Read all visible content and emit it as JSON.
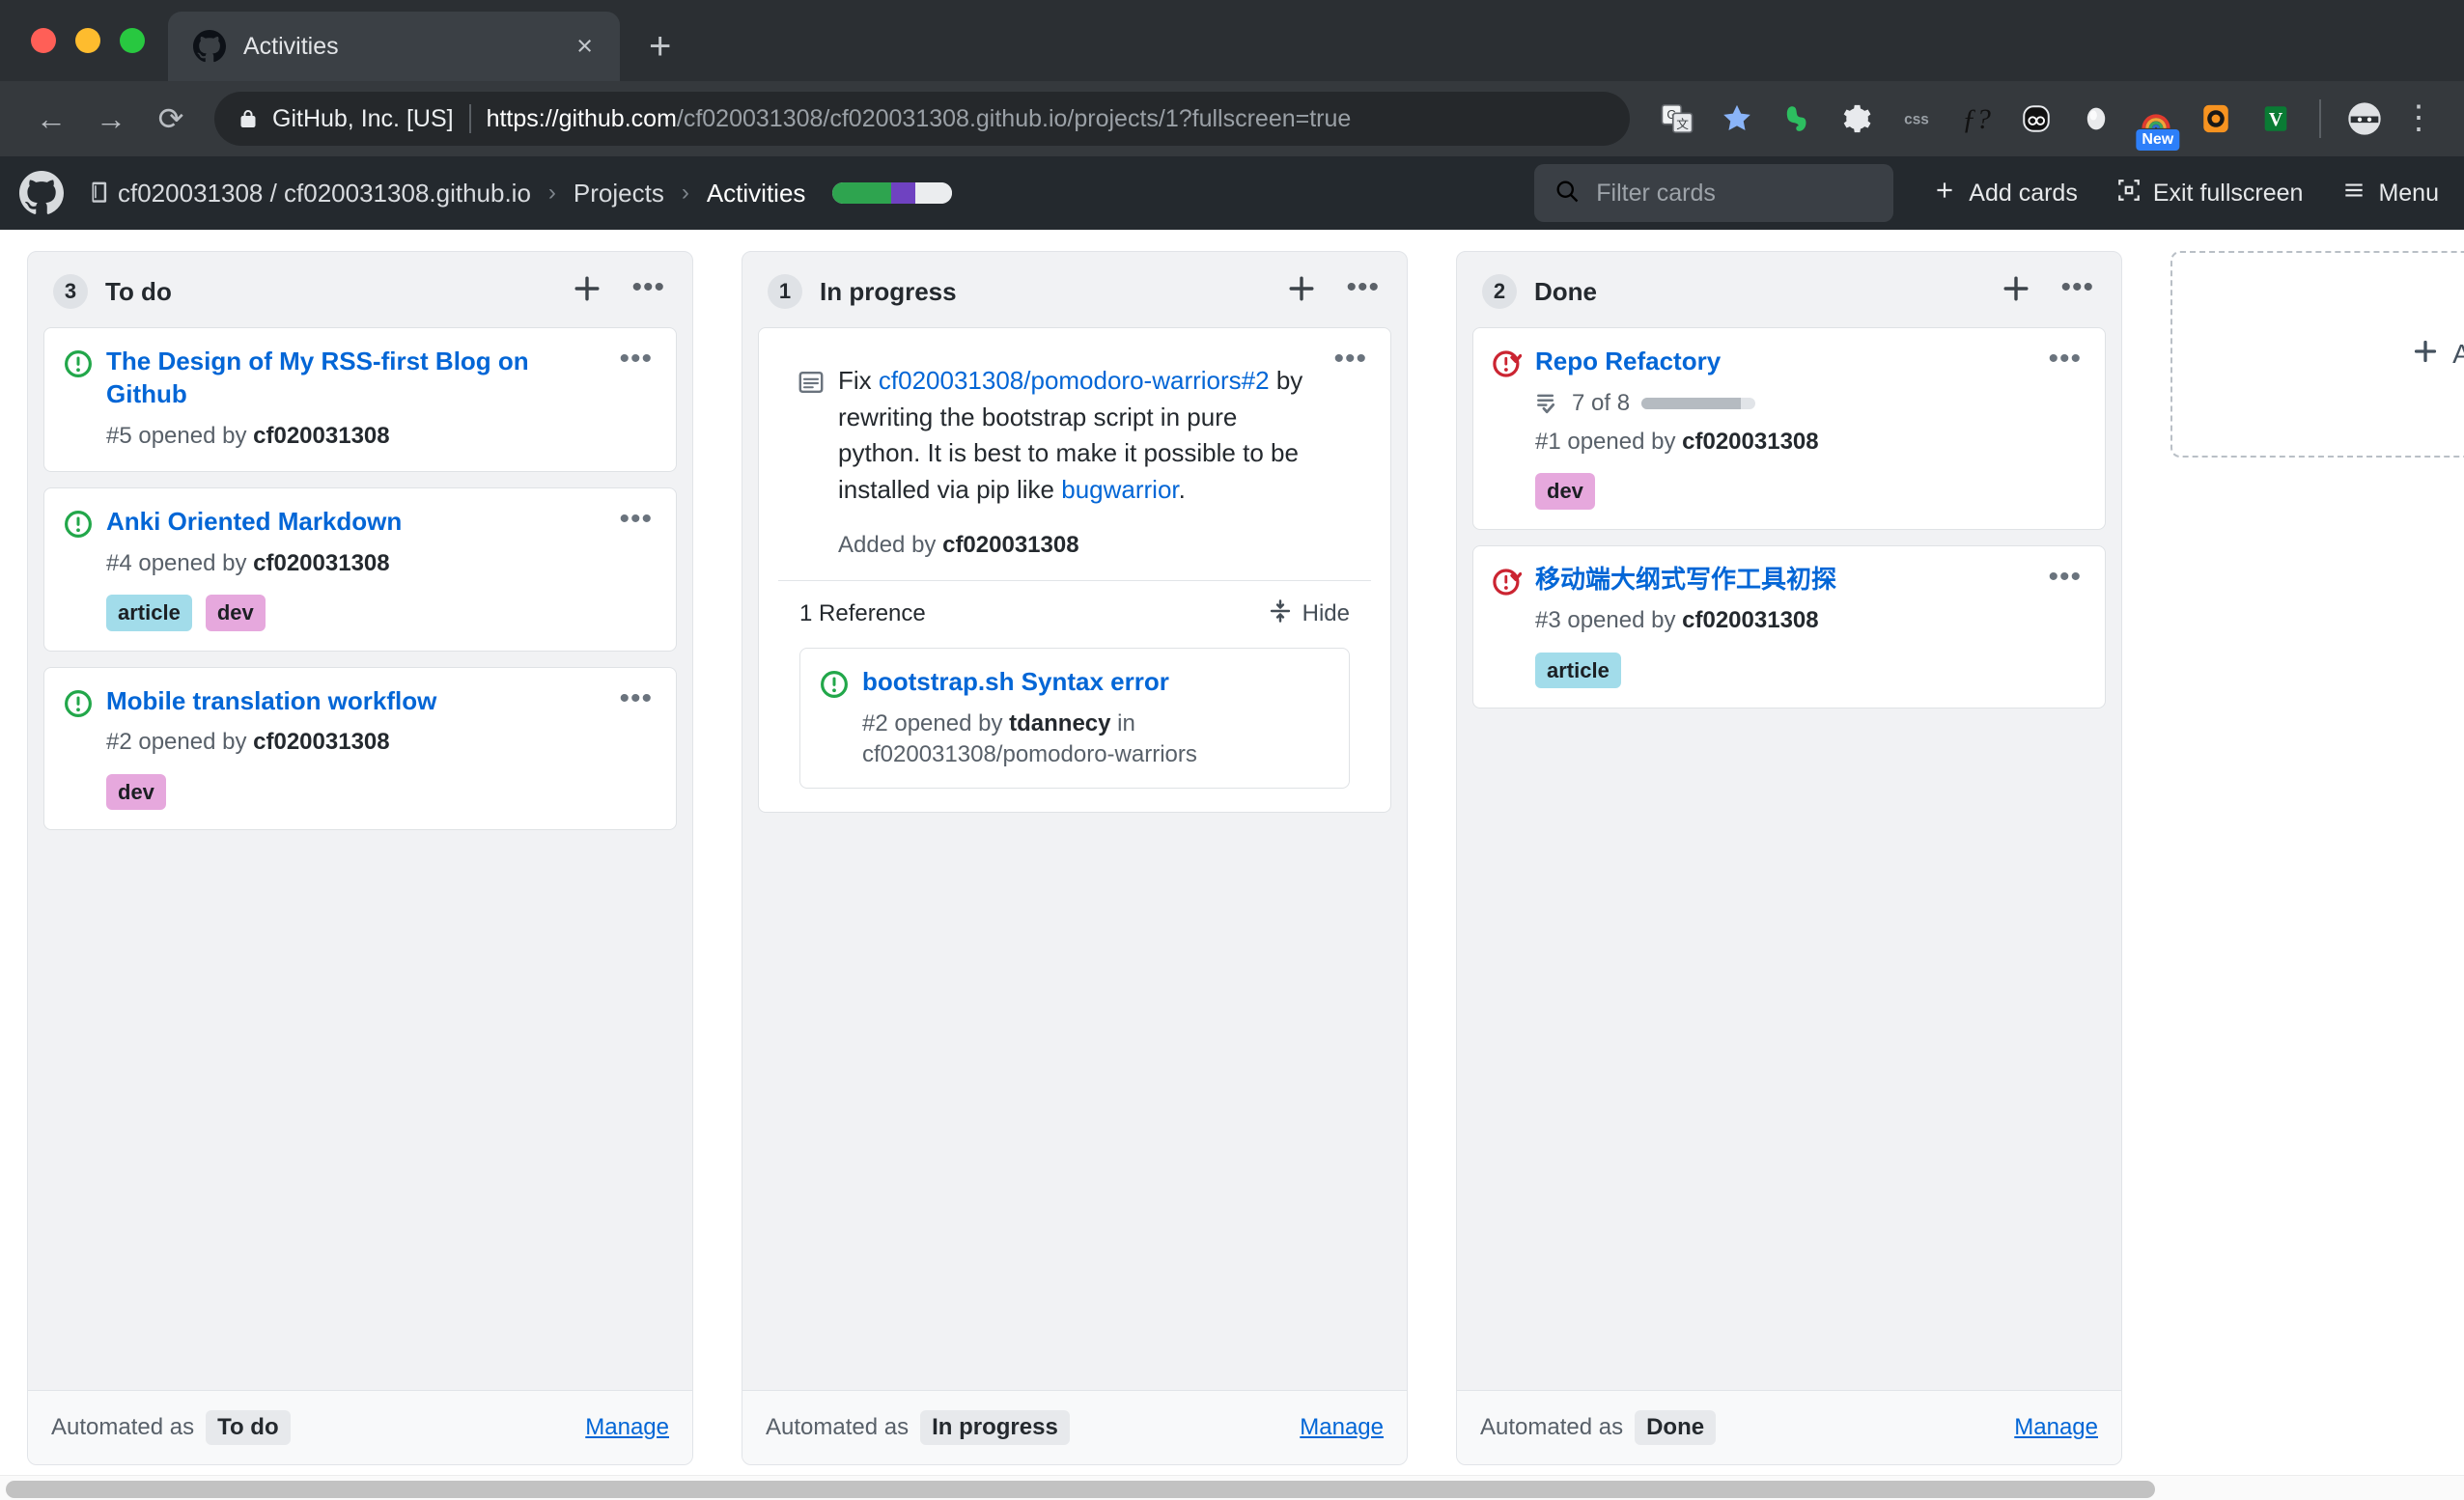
{
  "browser": {
    "tab": {
      "title": "Activities",
      "favicon": "github-icon",
      "close_label": "×"
    },
    "new_tab_label": "+",
    "nav": {
      "back": "←",
      "forward": "→",
      "reload": "⟳"
    },
    "omnibox": {
      "site_identity": "GitHub, Inc. [US]",
      "url_bold": "https://github.com",
      "url_dim": "/cf020031308/cf020031308.github.io/projects/1?fullscreen=true",
      "lock_icon": "lock-icon"
    },
    "extensions": [
      {
        "name": "google-translate-icon",
        "label": "G文"
      },
      {
        "name": "bookmark-star-icon",
        "label": "★"
      },
      {
        "name": "evernote-icon",
        "label": ""
      },
      {
        "name": "gear-icon",
        "label": "⚙"
      },
      {
        "name": "css-icon",
        "label": "css"
      },
      {
        "name": "function-icon",
        "label": "ƒ?"
      },
      {
        "name": "pocket-oo-icon",
        "label": "oo"
      },
      {
        "name": "gem-icon",
        "label": ""
      },
      {
        "name": "rainbow-arc-icon",
        "label": "",
        "badge": "New"
      },
      {
        "name": "orange-circle-icon",
        "label": ""
      },
      {
        "name": "vimium-v-icon",
        "label": "V"
      }
    ],
    "profile_icon": "avatar-ninja-icon",
    "menu_icon": "chrome-menu-icon"
  },
  "gh_header": {
    "logo": "github-mark-icon",
    "breadcrumb": {
      "repo_icon": "repo-book-icon",
      "owner_repo": "cf020031308 / cf020031308.github.io",
      "sep": "›",
      "projects": "Projects",
      "current": "Activities"
    },
    "progress": {
      "segments": [
        {
          "name": "done",
          "color": "#2ea44f",
          "pct": 49
        },
        {
          "name": "in-progress",
          "color": "#6f42c1",
          "pct": 20
        },
        {
          "name": "todo",
          "color": "#ebedef",
          "pct": 31
        }
      ]
    },
    "filter": {
      "placeholder": "Filter cards",
      "value": "",
      "icon": "search-icon"
    },
    "add_cards": {
      "label": "Add cards",
      "icon": "plus-icon"
    },
    "exit_fullscreen": {
      "label": "Exit fullscreen",
      "icon": "screen-normal-icon"
    },
    "menu": {
      "label": "Menu",
      "icon": "hamburger-icon"
    }
  },
  "board": {
    "add_column": {
      "label": "Add column",
      "icon": "plus-icon"
    },
    "columns": [
      {
        "name": "to-do",
        "count": "3",
        "title": "To do",
        "add_icon": "plus-icon",
        "menu_icon": "kebab-icon",
        "automated_prefix": "Automated as",
        "automated_value": "To do",
        "manage_label": "Manage",
        "cards": [
          {
            "type": "issue",
            "state": "open",
            "state_icon": "issue-open-icon",
            "title": "The Design of My RSS-first Blog on Github",
            "meta_prefix": "#5 opened by",
            "meta_user": "cf020031308",
            "labels": []
          },
          {
            "type": "issue",
            "state": "open",
            "state_icon": "issue-open-icon",
            "title": "Anki Oriented Markdown",
            "meta_prefix": "#4 opened by",
            "meta_user": "cf020031308",
            "labels": [
              {
                "text": "article",
                "color": "#a2dcea"
              },
              {
                "text": "dev",
                "color": "#e6a8dd"
              }
            ]
          },
          {
            "type": "issue",
            "state": "open",
            "state_icon": "issue-open-icon",
            "title": "Mobile translation workflow",
            "meta_prefix": "#2 opened by",
            "meta_user": "cf020031308",
            "labels": [
              {
                "text": "dev",
                "color": "#e6a8dd"
              }
            ]
          }
        ]
      },
      {
        "name": "in-progress",
        "count": "1",
        "title": "In progress",
        "add_icon": "plus-icon",
        "menu_icon": "kebab-icon",
        "automated_prefix": "Automated as",
        "automated_value": "In progress",
        "manage_label": "Manage",
        "cards": [
          {
            "type": "note",
            "state_icon": "note-icon",
            "note_parts": [
              {
                "kind": "text",
                "text": "Fix "
              },
              {
                "kind": "link",
                "text": "cf020031308/pomodoro-warriors#2"
              },
              {
                "kind": "text",
                "text": " by rewriting the bootstrap script in pure python. It is best to make it possible to be installed via pip like "
              },
              {
                "kind": "link",
                "text": "bugwarrior"
              },
              {
                "kind": "text",
                "text": "."
              }
            ],
            "added_prefix": "Added by",
            "added_user": "cf020031308",
            "references": {
              "count_label": "1 Reference",
              "hide_label": "Hide",
              "hide_icon": "fold-icon",
              "items": [
                {
                  "state": "open",
                  "state_icon": "issue-open-icon",
                  "title": "bootstrap.sh Syntax error",
                  "meta_prefix": "#2 opened by",
                  "meta_user": "tdannecy",
                  "meta_suffix": "in",
                  "meta_repo": "cf020031308/pomodoro-warriors"
                }
              ]
            }
          }
        ]
      },
      {
        "name": "done",
        "count": "2",
        "title": "Done",
        "add_icon": "plus-icon",
        "menu_icon": "kebab-icon",
        "automated_prefix": "Automated as",
        "automated_value": "Done",
        "manage_label": "Manage",
        "cards": [
          {
            "type": "issue",
            "state": "closed",
            "state_icon": "issue-closed-icon",
            "title": "Repo Refactory",
            "tasks": {
              "icon": "tasklist-icon",
              "text": "7 of 8",
              "done": 7,
              "total": 8
            },
            "meta_prefix": "#1 opened by",
            "meta_user": "cf020031308",
            "labels": [
              {
                "text": "dev",
                "color": "#e6a8dd"
              }
            ]
          },
          {
            "type": "issue",
            "state": "closed",
            "state_icon": "issue-closed-icon",
            "title": "移动端大纲式写作工具初探",
            "meta_prefix": "#3 opened by",
            "meta_user": "cf020031308",
            "labels": [
              {
                "text": "article",
                "color": "#a2dcea"
              }
            ]
          }
        ]
      }
    ]
  },
  "scrollbar": {
    "name": "horizontal-scrollbar"
  }
}
